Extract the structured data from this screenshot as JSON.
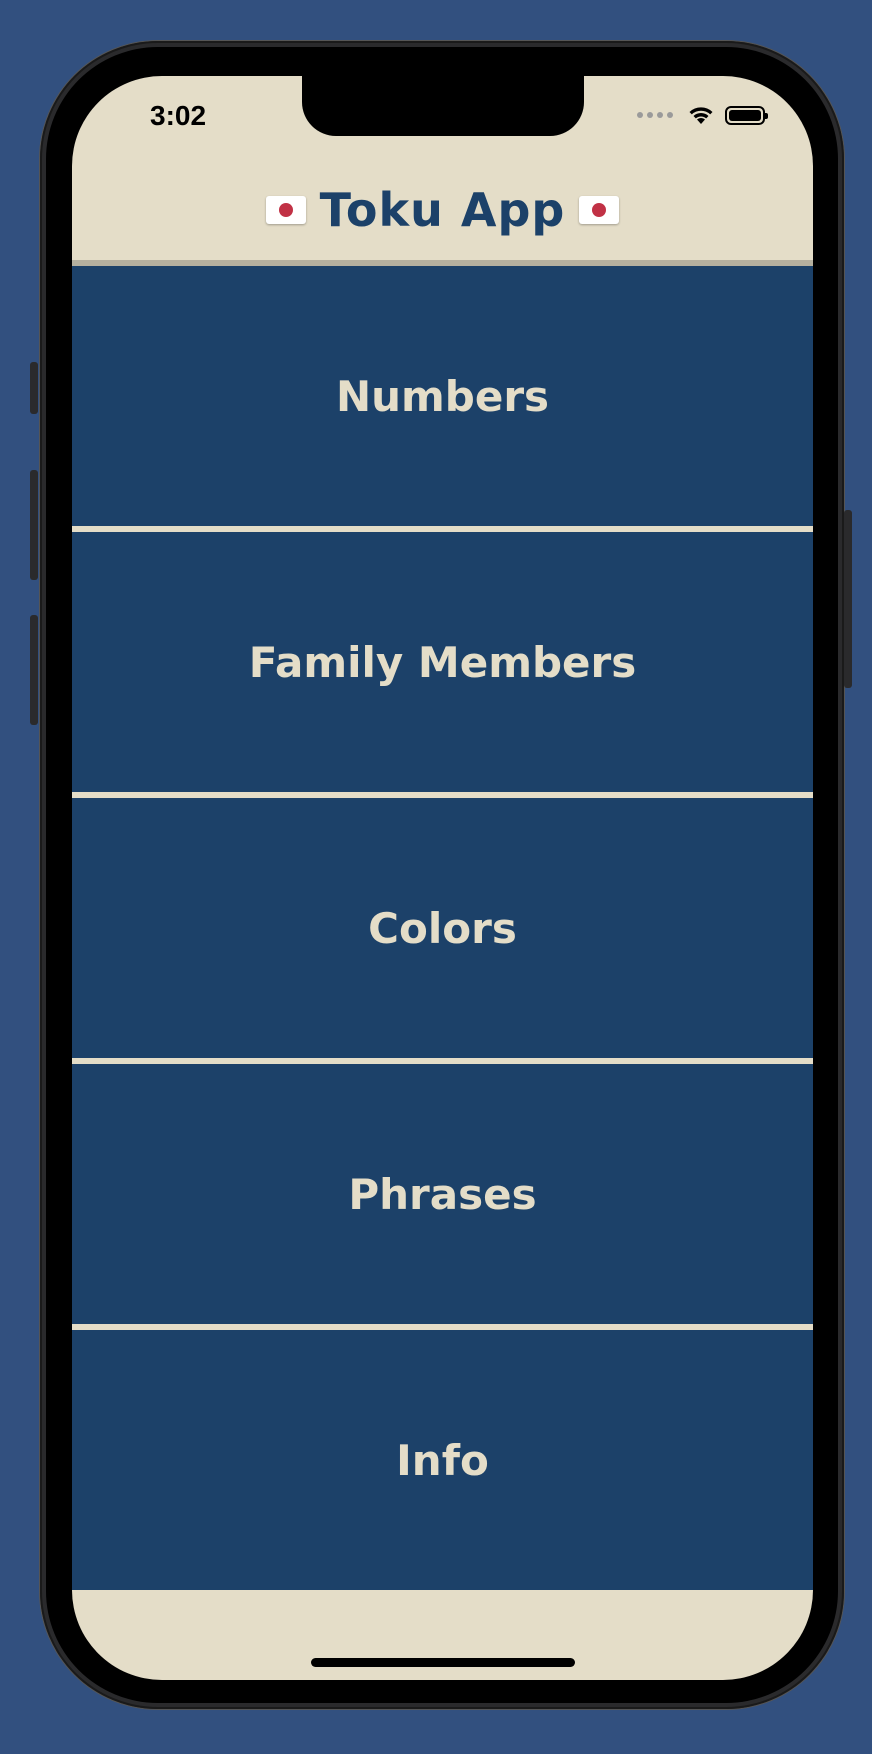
{
  "status_bar": {
    "time": "3:02",
    "icons": [
      "signal-dots-icon",
      "wifi-icon",
      "battery-icon"
    ]
  },
  "app_bar": {
    "title": "Toku App",
    "flag_icon": "japan-flag-icon"
  },
  "menu": {
    "items": [
      {
        "label": "Numbers"
      },
      {
        "label": "Family Members"
      },
      {
        "label": "Colors"
      },
      {
        "label": "Phrases"
      },
      {
        "label": "Info"
      }
    ]
  },
  "colors": {
    "background": "#32507f",
    "app_bar": "#e4ddc8",
    "menu_item": "#1c4169",
    "menu_text": "#e4ddc8",
    "title_text": "#1c4169",
    "flag_red": "#c13145"
  }
}
